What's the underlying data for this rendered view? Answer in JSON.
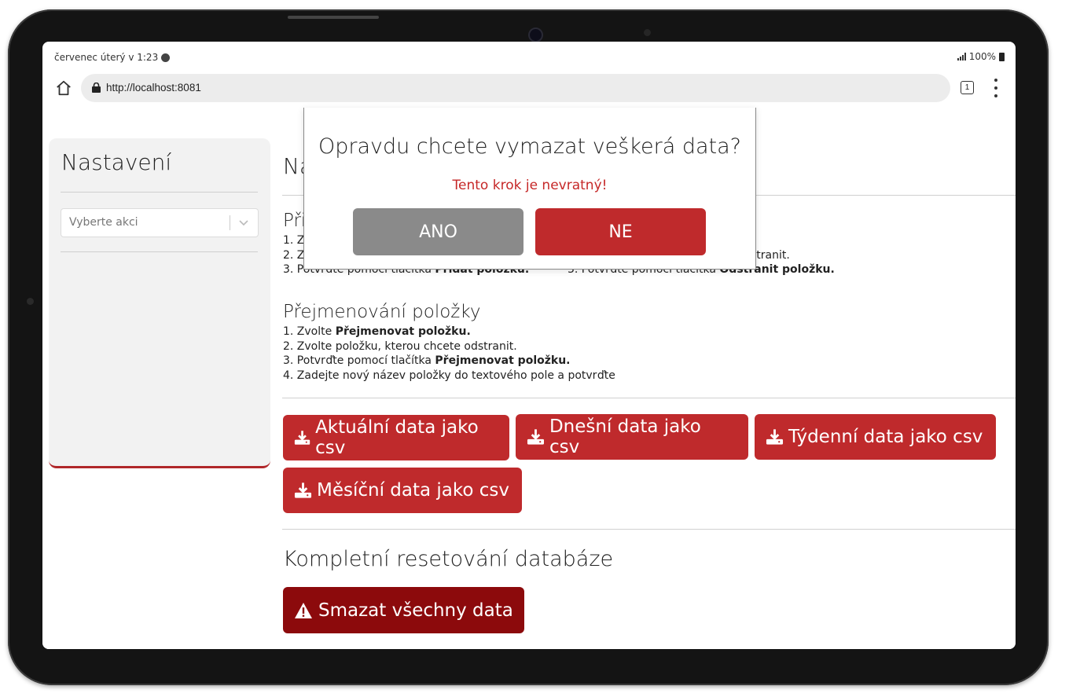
{
  "status_bar": {
    "time": "červenec úterý v 1:23",
    "battery": "100%"
  },
  "browser": {
    "url": "http://localhost:8081",
    "tab_count": "1"
  },
  "sidebar": {
    "title": "Nastavení",
    "select_placeholder": "Vyberte akci"
  },
  "main": {
    "heading_visible": "Na",
    "add_section": {
      "title_visible": "Při",
      "step1_visible": "1. Z",
      "step2_visible": "2. Z",
      "step3_prefix": "3. Potvrďte pomocí tlačítka ",
      "step3_bold": "Přidat položku."
    },
    "remove_section": {
      "step2_visible": "stranit.",
      "step3_prefix": "3. Potvrďte pomocí tlačítka ",
      "step3_bold": "Odstranit položku."
    },
    "rename_section": {
      "title": "Přejmenování položky",
      "step1_prefix": "1. Zvolte ",
      "step1_bold": "Přejmenovat položku.",
      "step2": "2. Zvolte položku, kterou chcete odstranit.",
      "step3_prefix": "3. Potvrďte pomocí tlačítka ",
      "step3_bold": "Přejmenovat položku.",
      "step4": "4. Zadejte nový název položky do textového pole a potvrďte"
    },
    "downloads": {
      "current": "Aktuální data jako csv",
      "today": "Dnešní data jako csv",
      "weekly": "Týdenní data jako csv",
      "monthly": "Měsíční data jako csv"
    },
    "reset_section": {
      "title": "Kompletní resetování databáze",
      "delete_button": "Smazat všechny data"
    }
  },
  "modal": {
    "title": "Opravdu chcete vymazat veškerá data?",
    "warning": "Tento krok je nevratný!",
    "yes": "ANO",
    "no": "NE"
  },
  "colors": {
    "primary_red": "#bf2a2c",
    "danger_dark_red": "#8c0a0c",
    "warning_text": "#c62828",
    "neutral_button": "#8a8a8a"
  }
}
